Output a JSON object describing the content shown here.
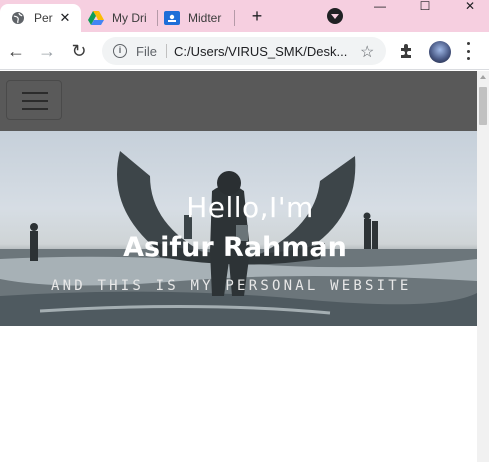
{
  "browser": {
    "tabs": [
      {
        "title": "Per",
        "icon": "globe-icon",
        "active": true
      },
      {
        "title": "My Dri",
        "icon": "google-drive-icon",
        "active": false
      },
      {
        "title": "Midter",
        "icon": "google-classroom-icon",
        "active": false
      }
    ],
    "new_tab_label": "+",
    "address": {
      "scheme_label": "File",
      "url": "C:/Users/VIRUS_SMK/Desk..."
    },
    "colors": {
      "tab_strip": "#f6cfe0",
      "toolbar": "#ffffff"
    }
  },
  "page": {
    "nav": {
      "menu_icon": "hamburger-icon",
      "background": "#595959"
    },
    "hero": {
      "greeting": "Hello,I'm",
      "name": "Asifur Rahman",
      "tagline": "AND THIS IS MY PERSONAL WEBSITE"
    }
  }
}
